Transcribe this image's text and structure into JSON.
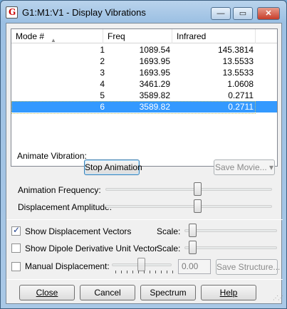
{
  "window": {
    "title": "G1:M1:V1 - Display Vibrations",
    "minimize": "—",
    "maximize": "▭",
    "close": "✕"
  },
  "table": {
    "columns": [
      "Mode #",
      "Freq",
      "Infrared"
    ],
    "rows": [
      {
        "mode": "1",
        "freq": "1089.54",
        "ir": "145.3814"
      },
      {
        "mode": "2",
        "freq": "1693.95",
        "ir": "13.5533"
      },
      {
        "mode": "3",
        "freq": "1693.95",
        "ir": "13.5533"
      },
      {
        "mode": "4",
        "freq": "3461.29",
        "ir": "1.0608"
      },
      {
        "mode": "5",
        "freq": "3589.82",
        "ir": "0.2711"
      },
      {
        "mode": "6",
        "freq": "3589.82",
        "ir": "0.2711"
      }
    ],
    "selected_row": 6
  },
  "animate": {
    "label": "Animate Vibration:",
    "stop_button": "Stop Animation",
    "save_movie": "Save Movie...",
    "frequency_label": "Animation Frequency:",
    "frequency_level": 0.55,
    "amplitude_label": "Displacement Amplitude:",
    "amplitude_level": 0.55
  },
  "options": {
    "show_vectors": {
      "label": "Show Displacement Vectors",
      "checked": true,
      "scale_label": "Scale:"
    },
    "show_dipole": {
      "label": "Show Dipole Derivative Unit Vector",
      "checked": false,
      "scale_label": "Scale:"
    },
    "manual": {
      "label": "Manual Displacement:",
      "checked": false,
      "value": "0.00",
      "save_structure": "Save Structure..."
    }
  },
  "buttons": {
    "close": "Close",
    "cancel": "Cancel",
    "spectrum": "Spectrum",
    "help": "Help"
  }
}
